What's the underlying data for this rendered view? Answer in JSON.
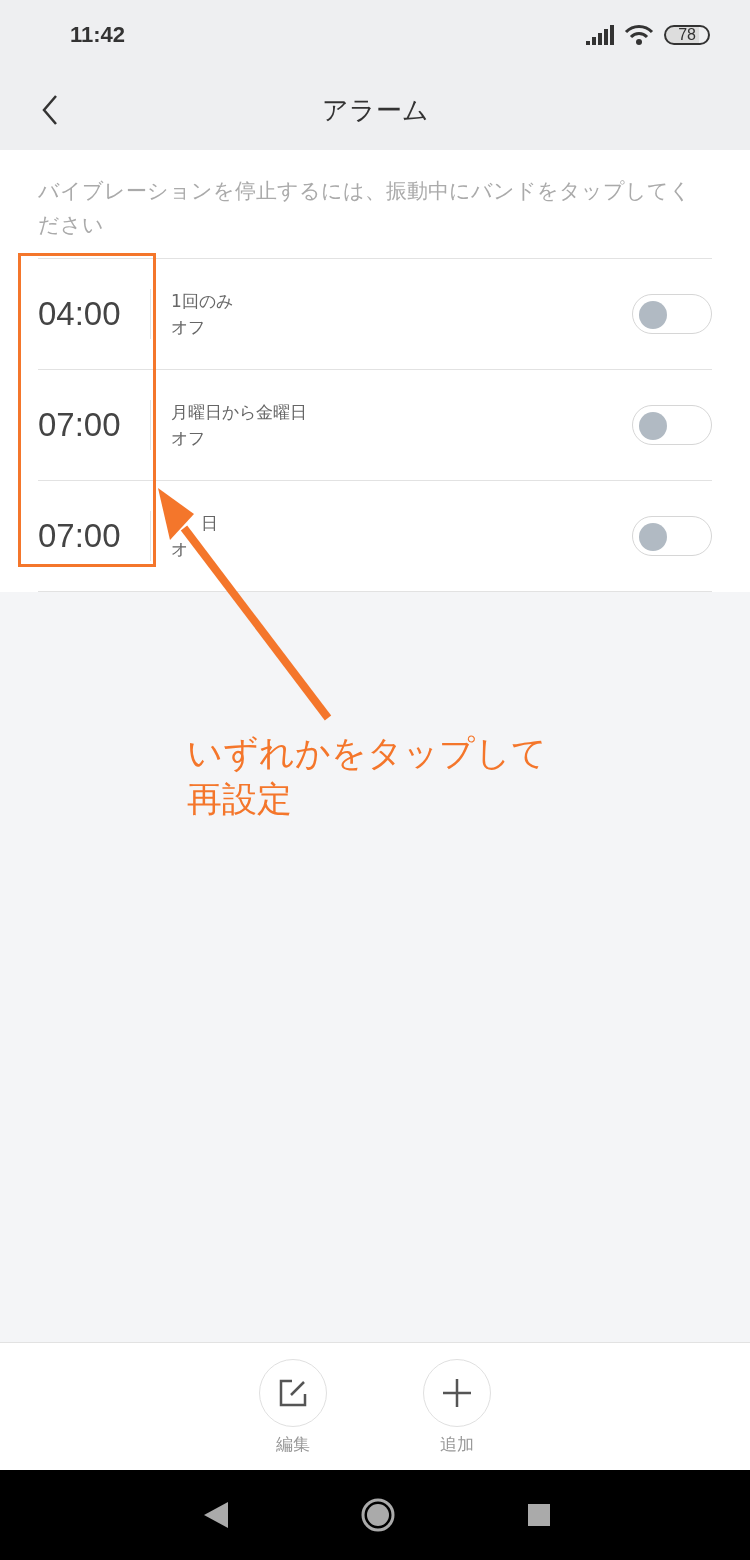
{
  "status_bar": {
    "time": "11:42",
    "battery": "78"
  },
  "header": {
    "title": "アラーム"
  },
  "note": "バイブレーションを停止するには、振動中にバンドをタップしてください",
  "alarms": [
    {
      "time": "04:00",
      "repeat": "1回のみ",
      "status": "オフ",
      "on": false
    },
    {
      "time": "07:00",
      "repeat": "月曜日から金曜日",
      "status": "オフ",
      "on": false
    },
    {
      "time": "07:00",
      "repeat": "日",
      "status": "オ",
      "on": false
    }
  ],
  "toolbar": [
    {
      "kind": "edit",
      "label": "編集"
    },
    {
      "kind": "add",
      "label": "追加"
    }
  ],
  "annotation": {
    "text": "いずれかをタップして再設定"
  }
}
